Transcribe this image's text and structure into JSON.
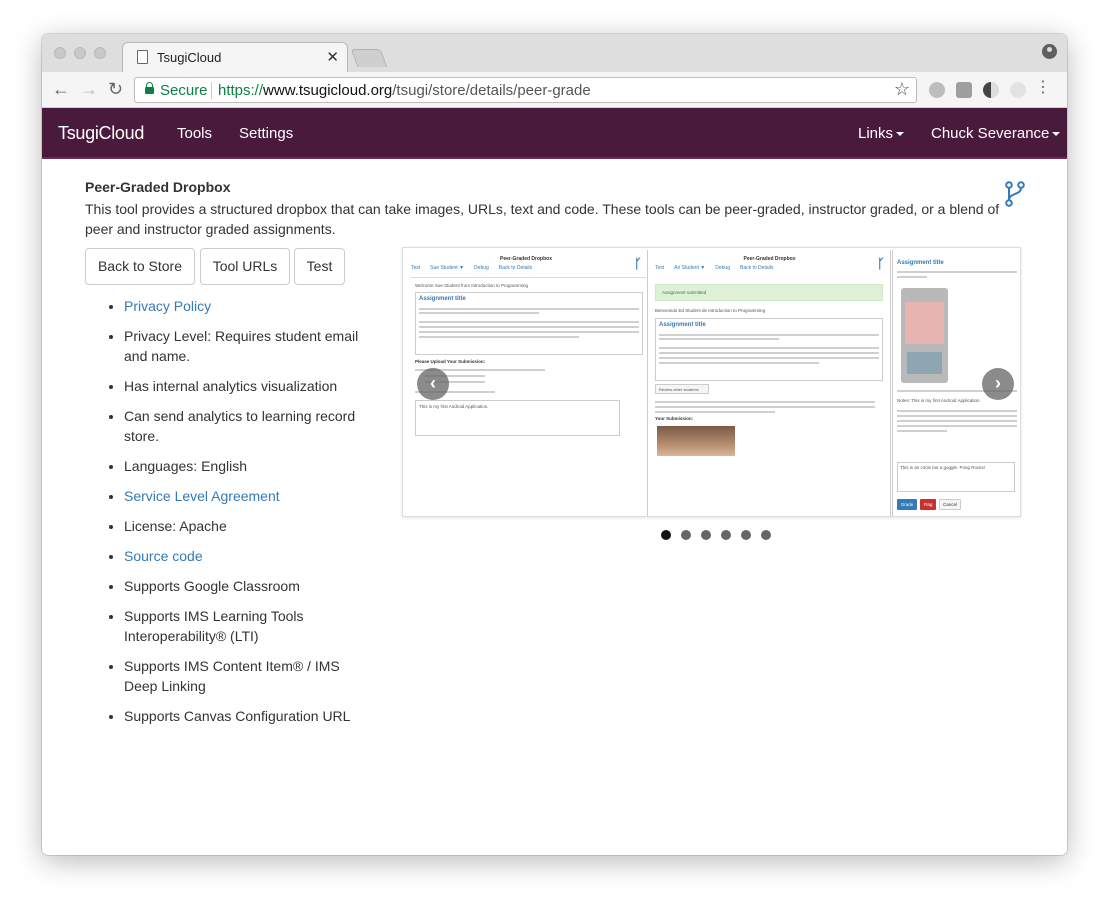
{
  "browser": {
    "tab_title": "TsugiCloud",
    "secure_label": "Secure",
    "url_scheme": "https://",
    "url_host": "www.tsugicloud.org",
    "url_path": "/tsugi/store/details/peer-grade"
  },
  "navbar": {
    "brand": "TsugiCloud",
    "tools": "Tools",
    "settings": "Settings",
    "links": "Links",
    "user": "Chuck Severance"
  },
  "page": {
    "title": "Peer-Graded Dropbox",
    "description": "This tool provides a structured dropbox that can take images, URLs, text and code. These tools can be peer-graded, instructor graded, or a blend of peer and instructor graded assignments."
  },
  "buttons": {
    "back": "Back to Store",
    "urls": "Tool URLs",
    "test": "Test"
  },
  "features": [
    {
      "text": "Privacy Policy",
      "link": true
    },
    {
      "text": "Privacy Level: Requires student email and name.",
      "link": false
    },
    {
      "text": "Has internal analytics visualization",
      "link": false
    },
    {
      "text": "Can send analytics to learning record store.",
      "link": false
    },
    {
      "text": "Languages: English",
      "link": false
    },
    {
      "text": "Service Level Agreement",
      "link": true
    },
    {
      "text": "License: Apache",
      "link": false
    },
    {
      "text": "Source code",
      "link": true
    },
    {
      "text": "Supports Google Classroom",
      "link": false
    },
    {
      "text": "Supports IMS Learning Tools Interoperability® (LTI)",
      "link": false
    },
    {
      "text": "Supports IMS Content Item® / IMS Deep Linking",
      "link": false
    },
    {
      "text": "Supports Canvas Configuration URL",
      "link": false
    }
  ],
  "carousel": {
    "slide_count": 6,
    "active_index": 0,
    "shot1": {
      "title": "Peer-Graded Dropbox",
      "tabs": [
        "Test",
        "Sue Student ▼",
        "Debug",
        "Back to Details"
      ],
      "welcome": "Welcome Sue Student from Introduction to Programming",
      "heading": "Assignment title",
      "upload_label": "Please Upload Your Submission:",
      "comment": "This is my first Android Application."
    },
    "shot2": {
      "title": "Peer-Graded Dropbox",
      "tabs": [
        "Test",
        "Ari Student ▼",
        "Debug",
        "Back to Details"
      ],
      "alert": "Assignment submitted",
      "welcome": "Bienvenido Ed Student de Introduction to Programming",
      "heading": "Assignment title",
      "review_btn": "Review other students",
      "submission_label": "Your Submission:"
    },
    "shot3": {
      "heading": "Assignment title",
      "notes": "Notes: This is my first Android Application.",
      "comment": "This is an circle but a goggle.  Pong Rocks!",
      "grade_btn": "Grade",
      "flag_btn": "Flag",
      "cancel_btn": "Cancel"
    }
  },
  "colors": {
    "navbar_bg": "#4a1a3d",
    "link": "#337ab7",
    "secure_green": "#0b8043"
  }
}
